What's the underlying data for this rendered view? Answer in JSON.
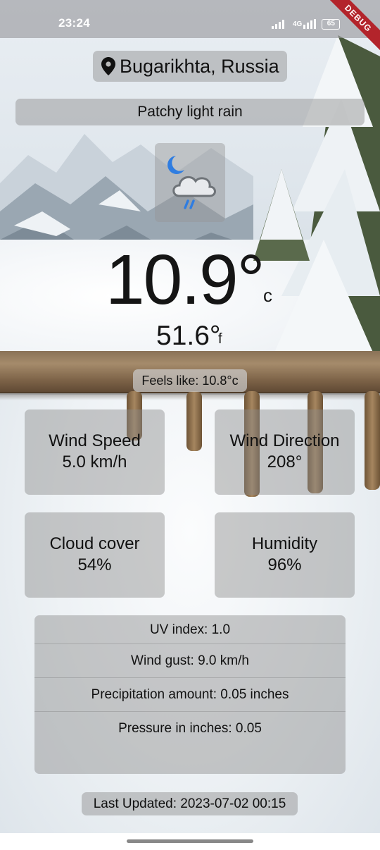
{
  "status_bar": {
    "time": "23:24",
    "network": "4G",
    "battery": "65",
    "debug_label": "DEBUG"
  },
  "location": {
    "icon": "location-pin-icon",
    "name": "Bugarikhta, Russia"
  },
  "condition": "Patchy light rain",
  "weather_icon": "moon-cloud-rain-icon",
  "temperature": {
    "celsius": "10.9°",
    "celsius_unit": "c",
    "fahrenheit": "51.6°",
    "fahrenheit_unit": "f",
    "feels_like": "Feels like: 10.8°c"
  },
  "tiles": [
    {
      "label": "Wind Speed",
      "value": "5.0 km/h"
    },
    {
      "label": "Wind Direction",
      "value": "208°"
    },
    {
      "label": "Cloud cover",
      "value": "54%"
    },
    {
      "label": "Humidity",
      "value": "96%"
    }
  ],
  "details": [
    "UV index: 1.0",
    "Wind gust: 9.0 km/h",
    "Precipitation amount: 0.05 inches",
    "Pressure in inches: 0.05"
  ],
  "last_updated": "Last Updated: 2023-07-02 00:15",
  "colors": {
    "accent_moon": "#2f7de1",
    "accent_rain": "#2f7de1",
    "debug_ribbon": "#b3242b",
    "card_bg": "rgba(140,140,140,0.45)"
  }
}
